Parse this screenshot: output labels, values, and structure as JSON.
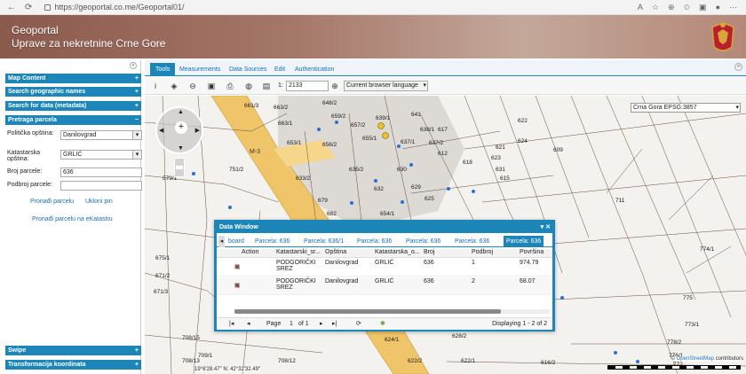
{
  "browser": {
    "url": "https://geoportal.co.me/Geoportal01/",
    "right_icons": [
      "reader-icon",
      "favorite-icon",
      "extensions-icon",
      "favorites-bar-icon",
      "collections-icon",
      "profile-icon",
      "more-icon"
    ]
  },
  "banner": {
    "title_line1": "Geoportal",
    "title_line2": "Uprave za nekretnine Crne Gore"
  },
  "left": {
    "sections": [
      {
        "label": "Map Content",
        "toggle": "+"
      },
      {
        "label": "Search geographic names",
        "toggle": "+"
      },
      {
        "label": "Search for data (metadata)",
        "toggle": "+"
      },
      {
        "label": "Pretraga parcela",
        "toggle": "−"
      }
    ],
    "form": {
      "municipality_label": "Politička opština:",
      "municipality_value": "Danilovgrad",
      "cadastral_label": "Katastarska opština:",
      "cadastral_value": "GRLIĆ",
      "parcel_no_label": "Broj parcele:",
      "parcel_no_value": "636",
      "subparcel_label": "Podbroj parcele:",
      "subparcel_value": ""
    },
    "links": {
      "find": "Pronađi parcelu",
      "remove_pin": "Ukloni pin",
      "ekatastar": "Pronađi parcelu na eKatastru"
    },
    "bottom_sections": [
      {
        "label": "Swipe",
        "toggle": "+"
      },
      {
        "label": "Transformacija koordinata",
        "toggle": "+"
      }
    ]
  },
  "map_tabs": [
    "Tools",
    "Measurements",
    "Data Sources",
    "Edit",
    "Authentication"
  ],
  "toolbar": {
    "scale_prefix": "1:",
    "scale_value": "2133",
    "language": "Current browser language"
  },
  "map": {
    "projection": "Crna Gora EPSG:3857",
    "coords": "19°6'28.47\" N: 42°32'32.49\"",
    "attribution_prefix": "©",
    "attribution_link": "OpenStreetMap",
    "attribution_suffix": "contributors",
    "road_label": "M-3",
    "parcel_labels": [
      "661/3",
      "663/2",
      "648/2",
      "659/2",
      "657/2",
      "639/1",
      "641",
      "638/1",
      "617",
      "622",
      "624",
      "621",
      "663/1",
      "653/1",
      "656/2",
      "655/1",
      "637/1",
      "637/2",
      "612",
      "618",
      "623",
      "631",
      "615",
      "609",
      "579/1",
      "751/2",
      "635/2",
      "630",
      "629",
      "711",
      "708/4",
      "704",
      "703",
      "682",
      "679",
      "675/1",
      "671/2",
      "671/3",
      "654/1",
      "652",
      "633/2",
      "632",
      "625",
      "774/1",
      "775",
      "773/1",
      "778/2",
      "776/1",
      "772",
      "709/1",
      "708/15",
      "708/13",
      "708/12",
      "624/1",
      "628/2",
      "622/2",
      "622/1",
      "616/2"
    ]
  },
  "data_window": {
    "title": "Data Window",
    "tabs": [
      "Parcela: 636",
      "Parcela: 636/1",
      "Parcela: 636",
      "Parcela: 636",
      "Parcela: 636",
      "Parcela: 636"
    ],
    "tab_partial": "board",
    "columns": [
      "Action",
      "Katastarski_sr...",
      "Opština",
      "Katastarska_o...",
      "Broj",
      "Podbroj",
      "Površina"
    ],
    "rows": [
      {
        "katastar": "PODGORIČKI SREZ",
        "opstina": "Danilovgrad",
        "ko": "GRLIĆ",
        "broj": "636",
        "podbroj": "1",
        "povrsina": "974.79"
      },
      {
        "katastar": "PODGORIČKI SREZ",
        "opstina": "Danilovgrad",
        "ko": "GRLIĆ",
        "broj": "636",
        "podbroj": "2",
        "povrsina": "68.07"
      }
    ],
    "pager": {
      "page_label": "Page",
      "page": "1",
      "of": "of 1",
      "status": "Displaying 1 - 2 of 2"
    }
  },
  "colors": {
    "accent": "#1d86b8",
    "link": "#1a6fb5",
    "road": "#f0c56a"
  }
}
